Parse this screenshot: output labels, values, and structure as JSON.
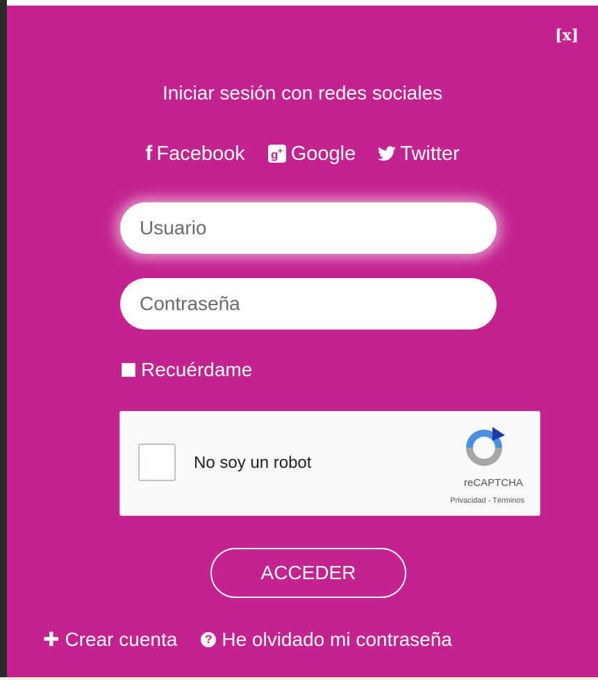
{
  "modal": {
    "close_label": "[x]",
    "social_title": "Iniciar sesión con redes sociales",
    "social": [
      {
        "label": "Facebook",
        "icon": "facebook-icon"
      },
      {
        "label": "Google",
        "icon": "google-plus-icon"
      },
      {
        "label": "Twitter",
        "icon": "twitter-icon"
      }
    ],
    "username_placeholder": "Usuario",
    "password_placeholder": "Contraseña",
    "remember_label": "Recuérdame",
    "submit_label": "ACCEDER"
  },
  "captcha": {
    "label": "No soy un robot",
    "brand": "reCAPTCHA",
    "links": "Privacidad - Términos"
  },
  "footer": {
    "create_account": "Crear cuenta",
    "forgot_password": "He olvidado mi contraseña"
  },
  "colors": {
    "background": "#c4238f",
    "text": "#ffffff"
  }
}
